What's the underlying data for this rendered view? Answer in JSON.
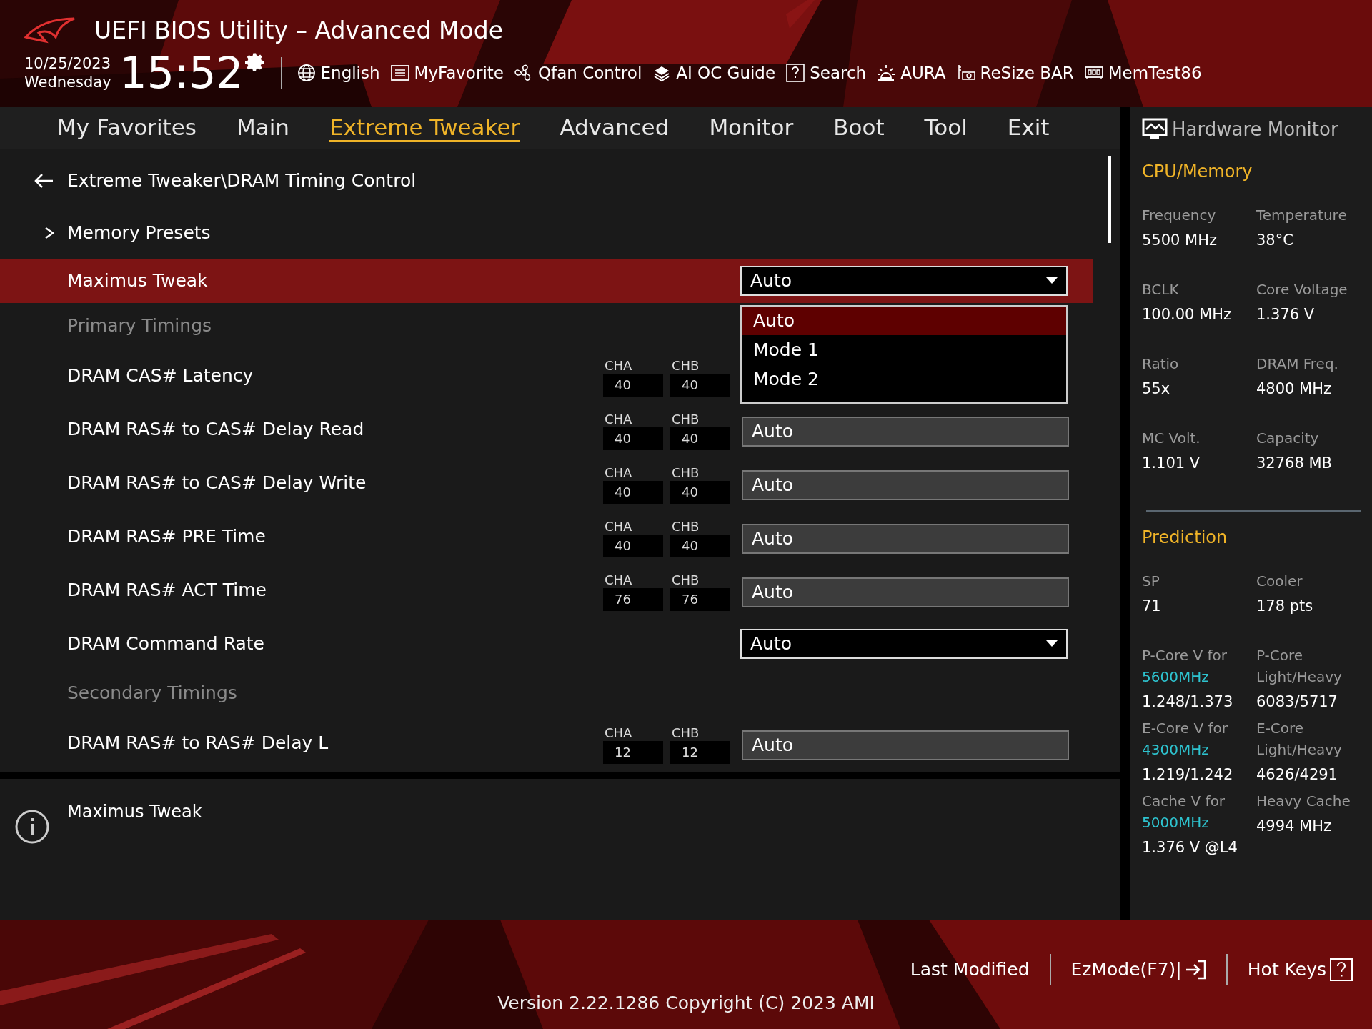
{
  "header": {
    "title": "UEFI BIOS Utility – Advanced Mode",
    "date": "10/25/2023",
    "weekday": "Wednesday",
    "time": "15:52",
    "toolbar": [
      {
        "label": "English"
      },
      {
        "label": "MyFavorite"
      },
      {
        "label": "Qfan Control"
      },
      {
        "label": "AI OC Guide"
      },
      {
        "label": "Search"
      },
      {
        "label": "AURA"
      },
      {
        "label": "ReSize BAR"
      },
      {
        "label": "MemTest86"
      }
    ]
  },
  "tabs": [
    {
      "label": "My Favorites",
      "selected": false
    },
    {
      "label": "Main",
      "selected": false
    },
    {
      "label": "Extreme Tweaker",
      "selected": true
    },
    {
      "label": "Advanced",
      "selected": false
    },
    {
      "label": "Monitor",
      "selected": false
    },
    {
      "label": "Boot",
      "selected": false
    },
    {
      "label": "Tool",
      "selected": false
    },
    {
      "label": "Exit",
      "selected": false
    }
  ],
  "breadcrumb": "Extreme Tweaker\\DRAM Timing Control",
  "rows": [
    {
      "kind": "submenu",
      "label": "Memory Presets"
    },
    {
      "kind": "select",
      "label": "Maximus Tweak",
      "value": "Auto",
      "selected": true,
      "expanded": true,
      "options": [
        {
          "label": "Auto",
          "selected": true
        },
        {
          "label": "Mode 1",
          "selected": false
        },
        {
          "label": "Mode 2",
          "selected": false
        }
      ]
    },
    {
      "kind": "section",
      "label": "Primary Timings"
    },
    {
      "kind": "timing",
      "label": "DRAM CAS# Latency",
      "cha_label": "CHA",
      "cha": "40",
      "chb_label": "CHB",
      "chb": "40"
    },
    {
      "kind": "timing",
      "label": "DRAM RAS# to CAS# Delay Read",
      "cha_label": "CHA",
      "cha": "40",
      "chb_label": "CHB",
      "chb": "40",
      "value": "Auto"
    },
    {
      "kind": "timing",
      "label": "DRAM RAS# to CAS# Delay Write",
      "cha_label": "CHA",
      "cha": "40",
      "chb_label": "CHB",
      "chb": "40",
      "value": "Auto"
    },
    {
      "kind": "timing",
      "label": "DRAM RAS# PRE Time",
      "cha_label": "CHA",
      "cha": "40",
      "chb_label": "CHB",
      "chb": "40",
      "value": "Auto"
    },
    {
      "kind": "timing",
      "label": "DRAM RAS# ACT Time",
      "cha_label": "CHA",
      "cha": "76",
      "chb_label": "CHB",
      "chb": "76",
      "value": "Auto"
    },
    {
      "kind": "select",
      "label": "DRAM Command Rate",
      "value": "Auto",
      "selected": false
    },
    {
      "kind": "section",
      "label": "Secondary Timings"
    },
    {
      "kind": "timing",
      "label": "DRAM RAS# to RAS# Delay L",
      "cha_label": "CHA",
      "cha": "12",
      "chb_label": "CHB",
      "chb": "12",
      "value": "Auto"
    }
  ],
  "help": {
    "title": "Maximus Tweak"
  },
  "monitor": {
    "title": "Hardware Monitor",
    "sections": [
      {
        "title": "CPU/Memory",
        "items": [
          {
            "label": "Frequency",
            "value": "5500 MHz"
          },
          {
            "label": "Temperature",
            "value": "38°C"
          },
          {
            "label": "BCLK",
            "value": "100.00 MHz"
          },
          {
            "label": "Core Voltage",
            "value": "1.376 V"
          },
          {
            "label": "Ratio",
            "value": "55x"
          },
          {
            "label": "DRAM Freq.",
            "value": "4800 MHz"
          },
          {
            "label": "MC Volt.",
            "value": "1.101 V"
          },
          {
            "label": "Capacity",
            "value": "32768 MB"
          }
        ]
      },
      {
        "title": "Prediction",
        "items": [
          {
            "label": "SP",
            "value": "71"
          },
          {
            "label": "Cooler",
            "value": "178 pts"
          },
          {
            "label": "P-Core V for",
            "freq": "5600MHz",
            "value": "1.248/1.373"
          },
          {
            "label": "P-Core Light/Heavy",
            "value": "6083/5717"
          },
          {
            "label": "E-Core V for",
            "freq": "4300MHz",
            "value": "1.219/1.242"
          },
          {
            "label": "E-Core Light/Heavy",
            "value": "4626/4291"
          },
          {
            "label": "Cache V for",
            "freq": "5000MHz",
            "value": "1.376 V @L4"
          },
          {
            "label": "Heavy Cache",
            "value": "4994 MHz"
          }
        ]
      }
    ]
  },
  "footer": {
    "buttons": [
      {
        "label": "Last Modified"
      },
      {
        "label": "EzMode(F7)|"
      },
      {
        "label": "Hot Keys"
      }
    ],
    "version": "Version 2.22.1286 Copyright (C) 2023 AMI"
  }
}
